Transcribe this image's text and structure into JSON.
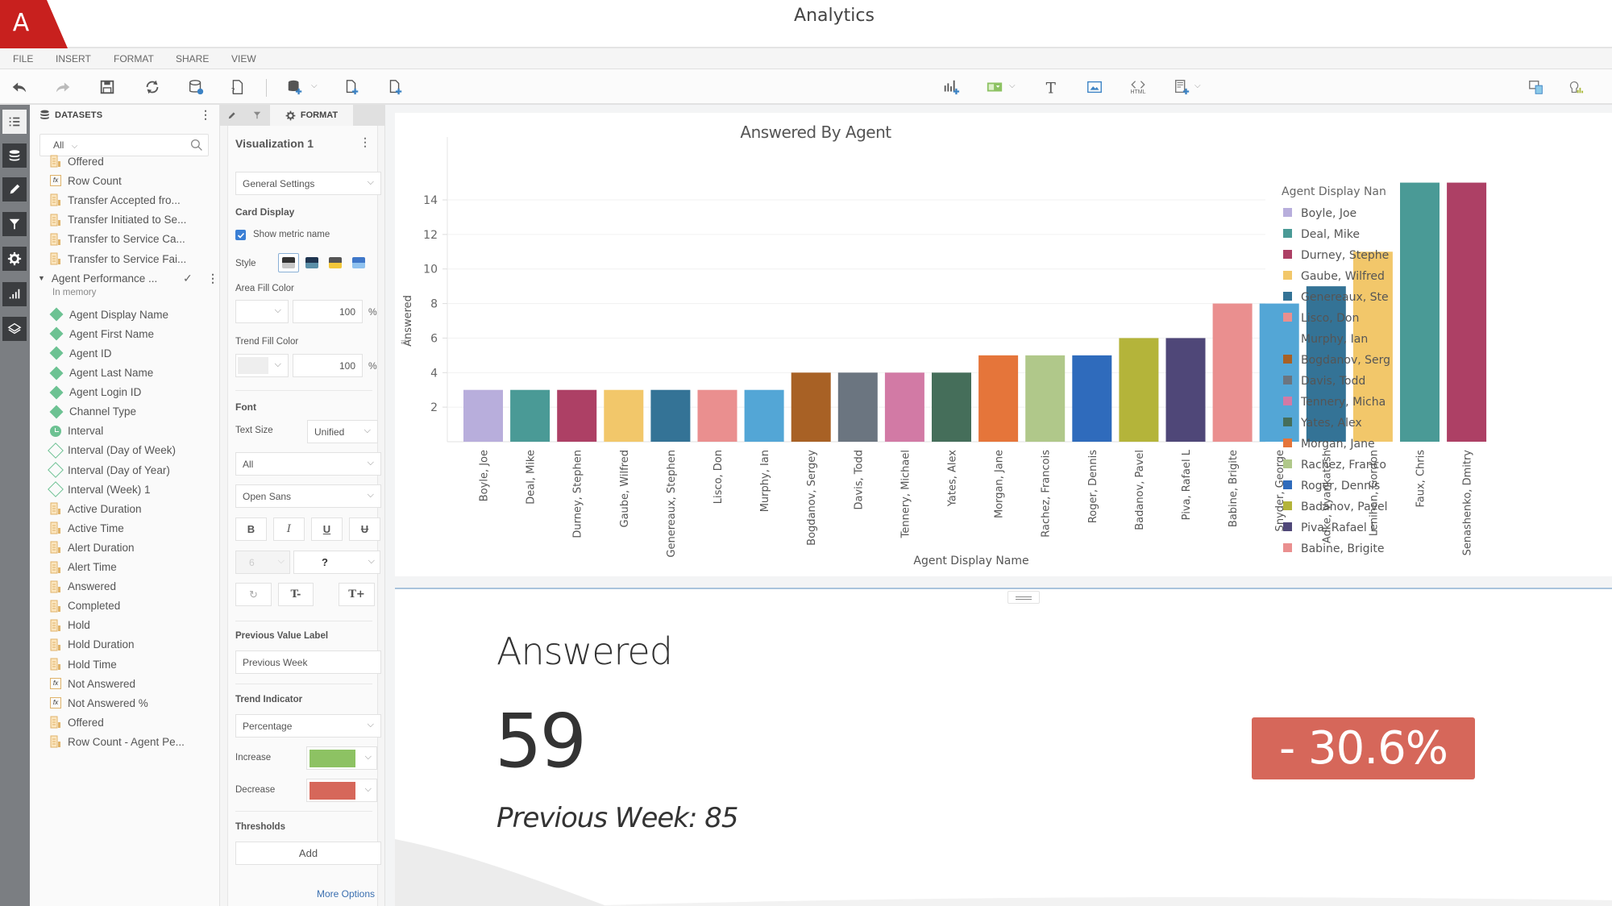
{
  "app": {
    "title": "Analytics",
    "brand_color": "#c8201e",
    "logo_letter": "A"
  },
  "menu": [
    "FILE",
    "INSERT",
    "FORMAT",
    "SHARE",
    "VIEW"
  ],
  "toolbar": {
    "left_icons": [
      "undo-icon",
      "redo-icon",
      "save-icon",
      "refresh-icon",
      "dataset-info-icon",
      "help-doc-icon",
      "add-dataset-icon",
      "add-page-icon",
      "new-document-icon"
    ],
    "right_icons": [
      "add-chart-icon",
      "add-filter-icon",
      "add-text-icon",
      "add-image-icon",
      "add-html-icon",
      "add-panel-icon"
    ],
    "far_right_icons": [
      "responsive-view-icon",
      "insights-icon"
    ],
    "html_label": "HTML"
  },
  "rail": [
    "list-icon",
    "datasets-icon",
    "edit-icon",
    "filter-icon",
    "settings-icon",
    "chart-icon",
    "layers-icon"
  ],
  "datasets": {
    "title": "DATASETS",
    "filter_value": "All",
    "items_top": [
      {
        "label": "Offered",
        "type": "measure"
      },
      {
        "label": "Row Count",
        "type": "fx-row"
      },
      {
        "label": "Transfer Accepted fro...",
        "type": "measure"
      },
      {
        "label": "Transfer Initiated to Se...",
        "type": "measure"
      },
      {
        "label": "Transfer to Service Ca...",
        "type": "measure"
      },
      {
        "label": "Transfer to Service Fai...",
        "type": "measure"
      }
    ],
    "group": {
      "label": "Agent Performance ...",
      "status": "In memory"
    },
    "items": [
      {
        "label": "Agent Display Name",
        "type": "attribute"
      },
      {
        "label": "Agent First Name",
        "type": "attribute"
      },
      {
        "label": "Agent ID",
        "type": "attribute"
      },
      {
        "label": "Agent Last Name",
        "type": "attribute"
      },
      {
        "label": "Agent Login ID",
        "type": "attribute"
      },
      {
        "label": "Channel Type",
        "type": "attribute"
      },
      {
        "label": "Interval",
        "type": "time"
      },
      {
        "label": "Interval (Day of Week)",
        "type": "derived"
      },
      {
        "label": "Interval (Day of Year)",
        "type": "derived"
      },
      {
        "label": "Interval (Week) 1",
        "type": "derived"
      },
      {
        "label": "Active Duration",
        "type": "measure"
      },
      {
        "label": "Active Time",
        "type": "measure"
      },
      {
        "label": "Alert Duration",
        "type": "measure"
      },
      {
        "label": "Alert Time",
        "type": "measure"
      },
      {
        "label": "Answered",
        "type": "measure"
      },
      {
        "label": "Completed",
        "type": "measure"
      },
      {
        "label": "Hold",
        "type": "measure"
      },
      {
        "label": "Hold Duration",
        "type": "measure"
      },
      {
        "label": "Hold Time",
        "type": "measure"
      },
      {
        "label": "Not Answered",
        "type": "fx"
      },
      {
        "label": "Not Answered %",
        "type": "fx"
      },
      {
        "label": "Offered",
        "type": "measure"
      },
      {
        "label": "Row Count - Agent Pe...",
        "type": "measure"
      }
    ]
  },
  "format_panel": {
    "tab_label": "FORMAT",
    "viz_title": "Visualization 1",
    "settings_select": "General Settings",
    "card_display": "Card Display",
    "show_metric_name": "Show metric name",
    "show_metric_checked": true,
    "style_label": "Style",
    "style_swatches": [
      {
        "top": "#333333",
        "bottom": "#c8c8c8"
      },
      {
        "top": "#1f3550",
        "bottom": "#5a8fa8"
      },
      {
        "top": "#555555",
        "bottom": "#f2c73a"
      },
      {
        "top": "#3f77c9",
        "bottom": "#8fc2ef"
      }
    ],
    "area_fill_label": "Area Fill Color",
    "area_fill_opacity": "100",
    "trend_fill_label": "Trend Fill Color",
    "trend_fill_opacity": "100",
    "percent_sign": "%",
    "font_label": "Font",
    "text_size_label": "Text Size",
    "text_size_value": "Unified",
    "font_scope": "All",
    "font_family": "Open Sans",
    "bold": "B",
    "italic": "I",
    "underline": "U",
    "strike": "U",
    "font_size_value": "6",
    "font_color_value": "?",
    "reset_label": "↻",
    "decrease_label": "T-",
    "increase_label": "T+",
    "previous_value_label": "Previous Value Label",
    "previous_value_input": "Previous Week",
    "trend_indicator_label": "Trend Indicator",
    "trend_indicator_value": "Percentage",
    "increase_label_text": "Increase",
    "increase_color": "#8dc263",
    "decrease_label_text": "Decrease",
    "decrease_color": "#d6675a",
    "thresholds_label": "Thresholds",
    "add_label": "Add",
    "more_options": "More Options"
  },
  "chart_data": {
    "type": "bar",
    "title": "Answered By Agent",
    "xlabel": "Agent Display Name",
    "ylabel": "Answered",
    "ylim": [
      0,
      16
    ],
    "yticks": [
      2,
      4,
      6,
      8,
      10,
      12,
      14
    ],
    "grid": true,
    "legend_title": "Agent Display Name",
    "legend_position": "right",
    "categories": [
      "Boyle, Joe",
      "Deal, Mike",
      "Durney, Stephen",
      "Gaube, Wilfred",
      "Genereaux, Stephen",
      "Lisco, Don",
      "Murphy, Ian",
      "Bogdanov, Sergey",
      "Davis, Todd",
      "Tennery, Michael",
      "Yates, Alex",
      "Morgan, Jane",
      "Rachez, Francois",
      "Roger, Dennis",
      "Badanov, Pavel",
      "Piva, Rafael L",
      "Babine, Brigite",
      "Snyder, George",
      "Adke, Vyankatesh",
      "Lenihan, Gordon",
      "Faux, Chris",
      "Senashenko, Dmitry"
    ],
    "values": [
      3,
      3,
      3,
      3,
      3,
      3,
      3,
      4,
      4,
      4,
      4,
      5,
      5,
      5,
      6,
      6,
      8,
      8,
      9,
      11,
      15,
      15
    ],
    "colors": [
      "#b8aedc",
      "#4a9a96",
      "#ad4065",
      "#f2c76a",
      "#347396",
      "#ea8f8f",
      "#53a6d6",
      "#a86125",
      "#6b7580",
      "#d27aa5",
      "#456e5a",
      "#e5753a",
      "#b0c88a",
      "#2f6bbc",
      "#b4b43a",
      "#4f4778",
      "#ea8f8f",
      "#53a6d6",
      "#347396",
      "#f2c76a",
      "#4a9a96",
      "#ad4065"
    ],
    "legend_visible": [
      "Boyle, Joe",
      "Deal, Mike",
      "Durney, Stephe",
      "Gaube, Wilfred",
      "Genereaux, Ste",
      "Lisco, Don",
      "Murphy, Ian",
      "Bogdanov, Serg",
      "Davis, Todd",
      "Tennery, Micha",
      "Yates, Alex",
      "Morgan, Jane",
      "Rachez, Franco",
      "Roger, Dennis",
      "Badanov, Pavel",
      "Piva, Rafael L",
      "Babine, Brigite"
    ],
    "legend_title_visible": "Agent Display Nan"
  },
  "kpi": {
    "metric_name": "Answered",
    "value": "59",
    "previous_label": "Previous Week: 85",
    "trend_text": "- 30.6%",
    "trend_color": "#d6675a",
    "trend_percent": -30.6,
    "previous_value": 85
  }
}
